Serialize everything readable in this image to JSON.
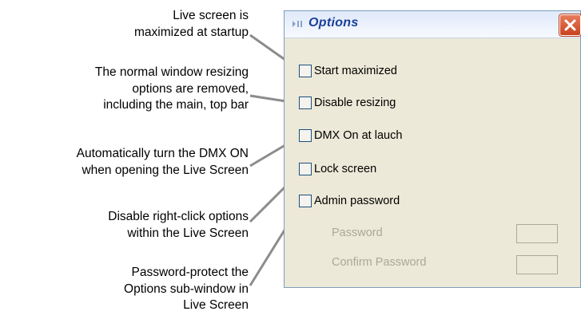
{
  "annotations": [
    {
      "id": "maximized",
      "text": "Live screen is\nmaximized at startup"
    },
    {
      "id": "resizing",
      "text": "The normal window resizing\noptions are removed,\nincluding the main, top bar"
    },
    {
      "id": "dmx",
      "text": "Automatically turn the DMX ON\nwhen opening the Live Screen"
    },
    {
      "id": "lock",
      "text": "Disable right-click options\nwithin the Live Screen"
    },
    {
      "id": "password",
      "text": "Password-protect the\nOptions sub-window in\nLive Screen"
    }
  ],
  "window": {
    "title": "Options",
    "options": [
      {
        "label": "Start maximized",
        "checked": false
      },
      {
        "label": "Disable resizing",
        "checked": false
      },
      {
        "label": "DMX On at lauch",
        "checked": false
      },
      {
        "label": "Lock screen",
        "checked": false
      },
      {
        "label": "Admin password",
        "checked": false
      }
    ],
    "password_label": "Password",
    "confirm_password_label": "Confirm Password"
  },
  "colors": {
    "arrow": "#8c8c8c",
    "title_text": "#1b3f9a",
    "window_bg": "#ece9d8",
    "close_button": "#d2532b",
    "disabled_text": "#aca899"
  },
  "icons": {
    "grip": "grip-icon",
    "close": "close-icon"
  }
}
